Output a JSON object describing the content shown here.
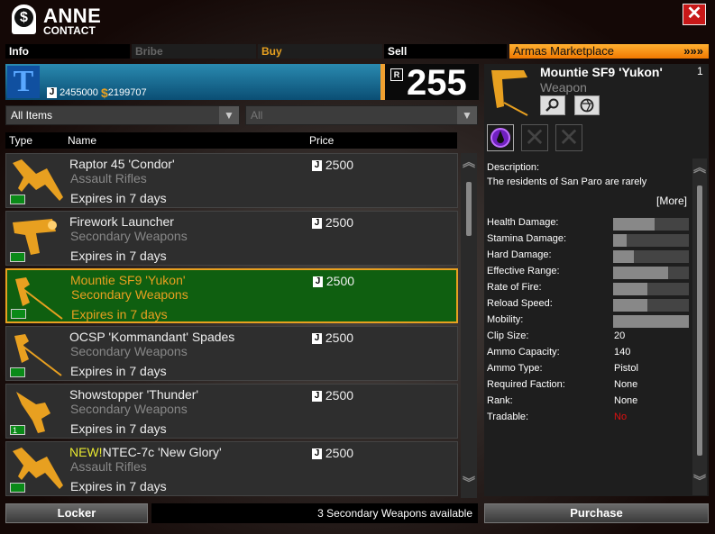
{
  "header": {
    "name": "ANNE",
    "subtitle": "CONTACT",
    "close": "✕"
  },
  "tabs": {
    "info": "Info",
    "bribe": "Bribe",
    "buy": "Buy",
    "sell": "Sell",
    "market": "Armas Marketplace",
    "market_arrows": "»»»"
  },
  "faction": {
    "logo": "T",
    "jc": "J",
    "credits": "2455000",
    "dollar": "$",
    "money": "2199707",
    "rank_badge": "R",
    "rank": "255"
  },
  "filters": {
    "category": "All Items",
    "subcategory": "All",
    "dropdown": "▼"
  },
  "columns": {
    "type": "Type",
    "name": "Name",
    "price": "Price"
  },
  "items": [
    {
      "name": "Raptor 45 'Condor'",
      "new": "",
      "category": "Assault Rifles",
      "expires": "Expires in 7 days",
      "price": "2500",
      "count": "",
      "icon": "rifle-icon"
    },
    {
      "name": "Firework Launcher",
      "new": "",
      "category": "Secondary Weapons",
      "expires": "Expires in 7 days",
      "price": "2500",
      "count": "",
      "icon": "launcher-icon"
    },
    {
      "name": "Mountie SF9 'Yukon'",
      "new": "",
      "category": "Secondary Weapons",
      "expires": "Expires in 7 days",
      "price": "2500",
      "count": "",
      "icon": "pistol-icon"
    },
    {
      "name": "OCSP 'Kommandant' Spades",
      "new": "",
      "category": "Secondary Weapons",
      "expires": "Expires in 7 days",
      "price": "2500",
      "count": "",
      "icon": "pistol-icon"
    },
    {
      "name": "Showstopper 'Thunder'",
      "new": "",
      "category": "Secondary Weapons",
      "expires": "Expires in 7 days",
      "price": "2500",
      "count": "1",
      "icon": "revolver-icon"
    },
    {
      "name": "NTEC-7c 'New Glory'",
      "new": "NEW!",
      "category": "Assault Rifles",
      "expires": "Expires in 7 days",
      "price": "2500",
      "count": "",
      "icon": "rifle-icon"
    }
  ],
  "selected_index": 2,
  "footer": {
    "locker": "Locker",
    "available": "3 Secondary Weapons available",
    "purchase": "Purchase"
  },
  "detail": {
    "name": "Mountie SF9 'Yukon'",
    "type": "Weapon",
    "quantity": "1",
    "description_label": "Description:",
    "description": "The residents of San Paro are rarely",
    "more": "[More]",
    "bars": [
      {
        "label": "Health Damage:",
        "level": 0.55
      },
      {
        "label": "Stamina Damage:",
        "level": 0.18
      },
      {
        "label": "Hard Damage:",
        "level": 0.27
      },
      {
        "label": "Effective Range:",
        "level": 0.73
      },
      {
        "label": "Rate of Fire:",
        "level": 0.45
      },
      {
        "label": "Reload Speed:",
        "level": 0.45
      },
      {
        "label": "Mobility:",
        "level": 1.0
      }
    ],
    "values": [
      {
        "label": "Clip Size:",
        "value": "20"
      },
      {
        "label": "Ammo Capacity:",
        "value": "140"
      },
      {
        "label": "Ammo Type:",
        "value": "Pistol"
      },
      {
        "label": "Required Faction:",
        "value": "None"
      },
      {
        "label": "Rank:",
        "value": "None"
      },
      {
        "label": "Tradable:",
        "value": "No"
      }
    ]
  },
  "colors": {
    "accent": "#e8a020",
    "selected_bg": "#0f5f10",
    "tradable_no": "#e01010"
  }
}
